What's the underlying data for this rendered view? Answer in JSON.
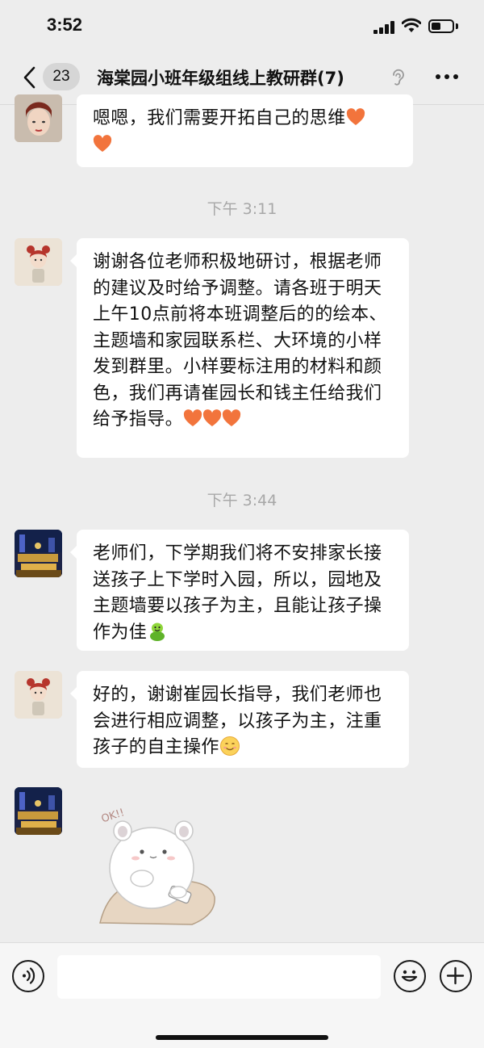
{
  "status_bar": {
    "time": "3:52",
    "battery_percent": 45
  },
  "nav": {
    "unread_count": "23",
    "title": "海棠园小班年级组线上教研群(7)"
  },
  "messages": [
    {
      "text": "嗯嗯，我们需要开拓自己的思维"
    },
    {
      "timestamp": "下午 3:11"
    },
    {
      "text": "谢谢各位老师积极地研讨，根据老师的建议及时给予调整。请各班于明天上午10点前将本班调整后的的绘本、主题墙和家园联系栏、大环境的小样发到群里。小样要标注用的材料和颜色，我们再请崔园长和钱主任给我们给予指导。"
    },
    {
      "timestamp": "下午 3:44"
    },
    {
      "text": "老师们，下学期我们将不安排家长接送孩子上下学时入园，所以，园地及主题墙要以孩子为主，且能让孩子操作为佳"
    },
    {
      "text": "好的，谢谢崔园长指导，我们老师也会进行相应调整，以孩子为主，注重孩子的自主操作"
    },
    {
      "sticker_caption": "OK!!"
    }
  ],
  "colors": {
    "background": "#ededed",
    "bubble": "#ffffff",
    "heart": "#f2743c",
    "timestamp": "#a8a8a8"
  },
  "icons": [
    "back-chevron-icon",
    "ear-icon",
    "more-icon",
    "voice-icon",
    "emoji-icon",
    "plus-icon",
    "heart-emoji-icon",
    "lol-emoji-icon",
    "smile-emoji-icon"
  ]
}
